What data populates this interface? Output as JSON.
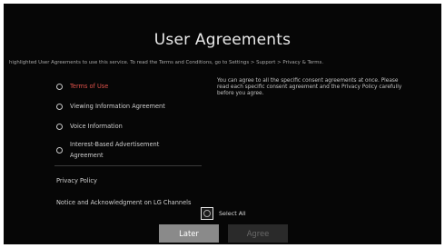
{
  "dialog": {
    "title": "User Agreements",
    "notice": "highlighted User Agreements to use this service. To read the Terms and Conditions, go to Settings > Support > Privacy & Terms."
  },
  "agreements": [
    {
      "label": "Terms of Use",
      "highlighted": true
    },
    {
      "label": "Viewing Information Agreement",
      "highlighted": false
    },
    {
      "label": "Voice Information",
      "highlighted": false
    },
    {
      "label": "Interest-Based Advertisement Agreement",
      "highlighted": false
    }
  ],
  "policies": [
    {
      "label": "Privacy Policy"
    },
    {
      "label": "Notice and Acknowledgment on LG Channels"
    }
  ],
  "description": "You can agree to all the specific consent agreements at once. Please read each specific consent agreement and the Privacy Policy carefully before you agree.",
  "select_all": {
    "label": "Select All"
  },
  "buttons": {
    "later": "Later",
    "agree": "Agree"
  },
  "colors": {
    "highlight": "#e0524a",
    "background": "#060606",
    "later_button": "#8a8a8a",
    "agree_button_disabled": "#2a2a2a"
  }
}
